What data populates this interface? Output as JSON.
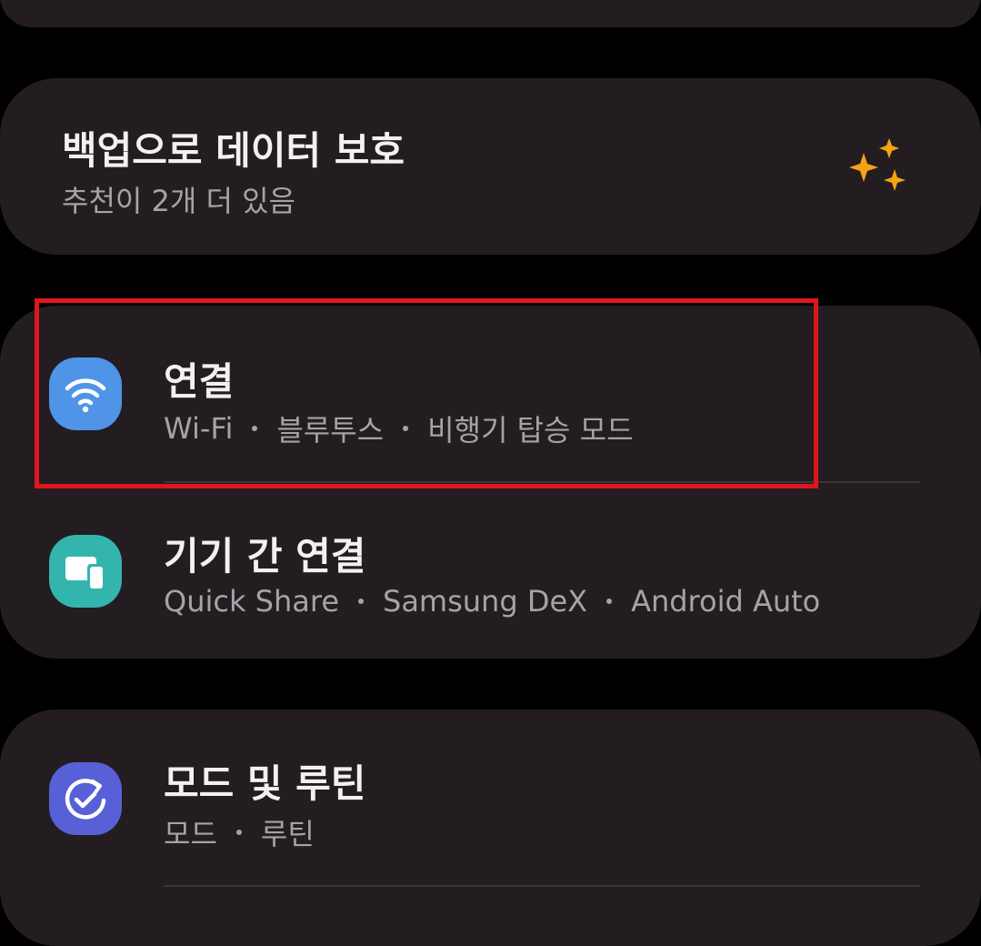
{
  "backup": {
    "title": "백업으로 데이터 보호",
    "subtitle": "추천이 2개 더 있음",
    "icon": "sparkle-icon",
    "icon_color": "#f6a313"
  },
  "settings": [
    {
      "title": "연결",
      "subtitle_parts": [
        "Wi-Fi",
        "블루투스",
        "비행기 탑승 모드"
      ],
      "icon": "wifi-icon",
      "icon_color": "#4f94e6",
      "highlighted": true
    },
    {
      "title": "기기 간 연결",
      "subtitle_parts": [
        "Quick Share",
        "Samsung DeX",
        "Android Auto"
      ],
      "icon": "devices-icon",
      "icon_color": "#33b5ad"
    },
    {
      "title": "모드 및 루틴",
      "subtitle_parts": [
        "모드",
        "루틴"
      ],
      "icon": "check-circle-icon",
      "icon_color": "#5760d6"
    }
  ],
  "colors": {
    "background": "#000000",
    "card": "#231d22",
    "highlight_border": "#e0161e"
  }
}
